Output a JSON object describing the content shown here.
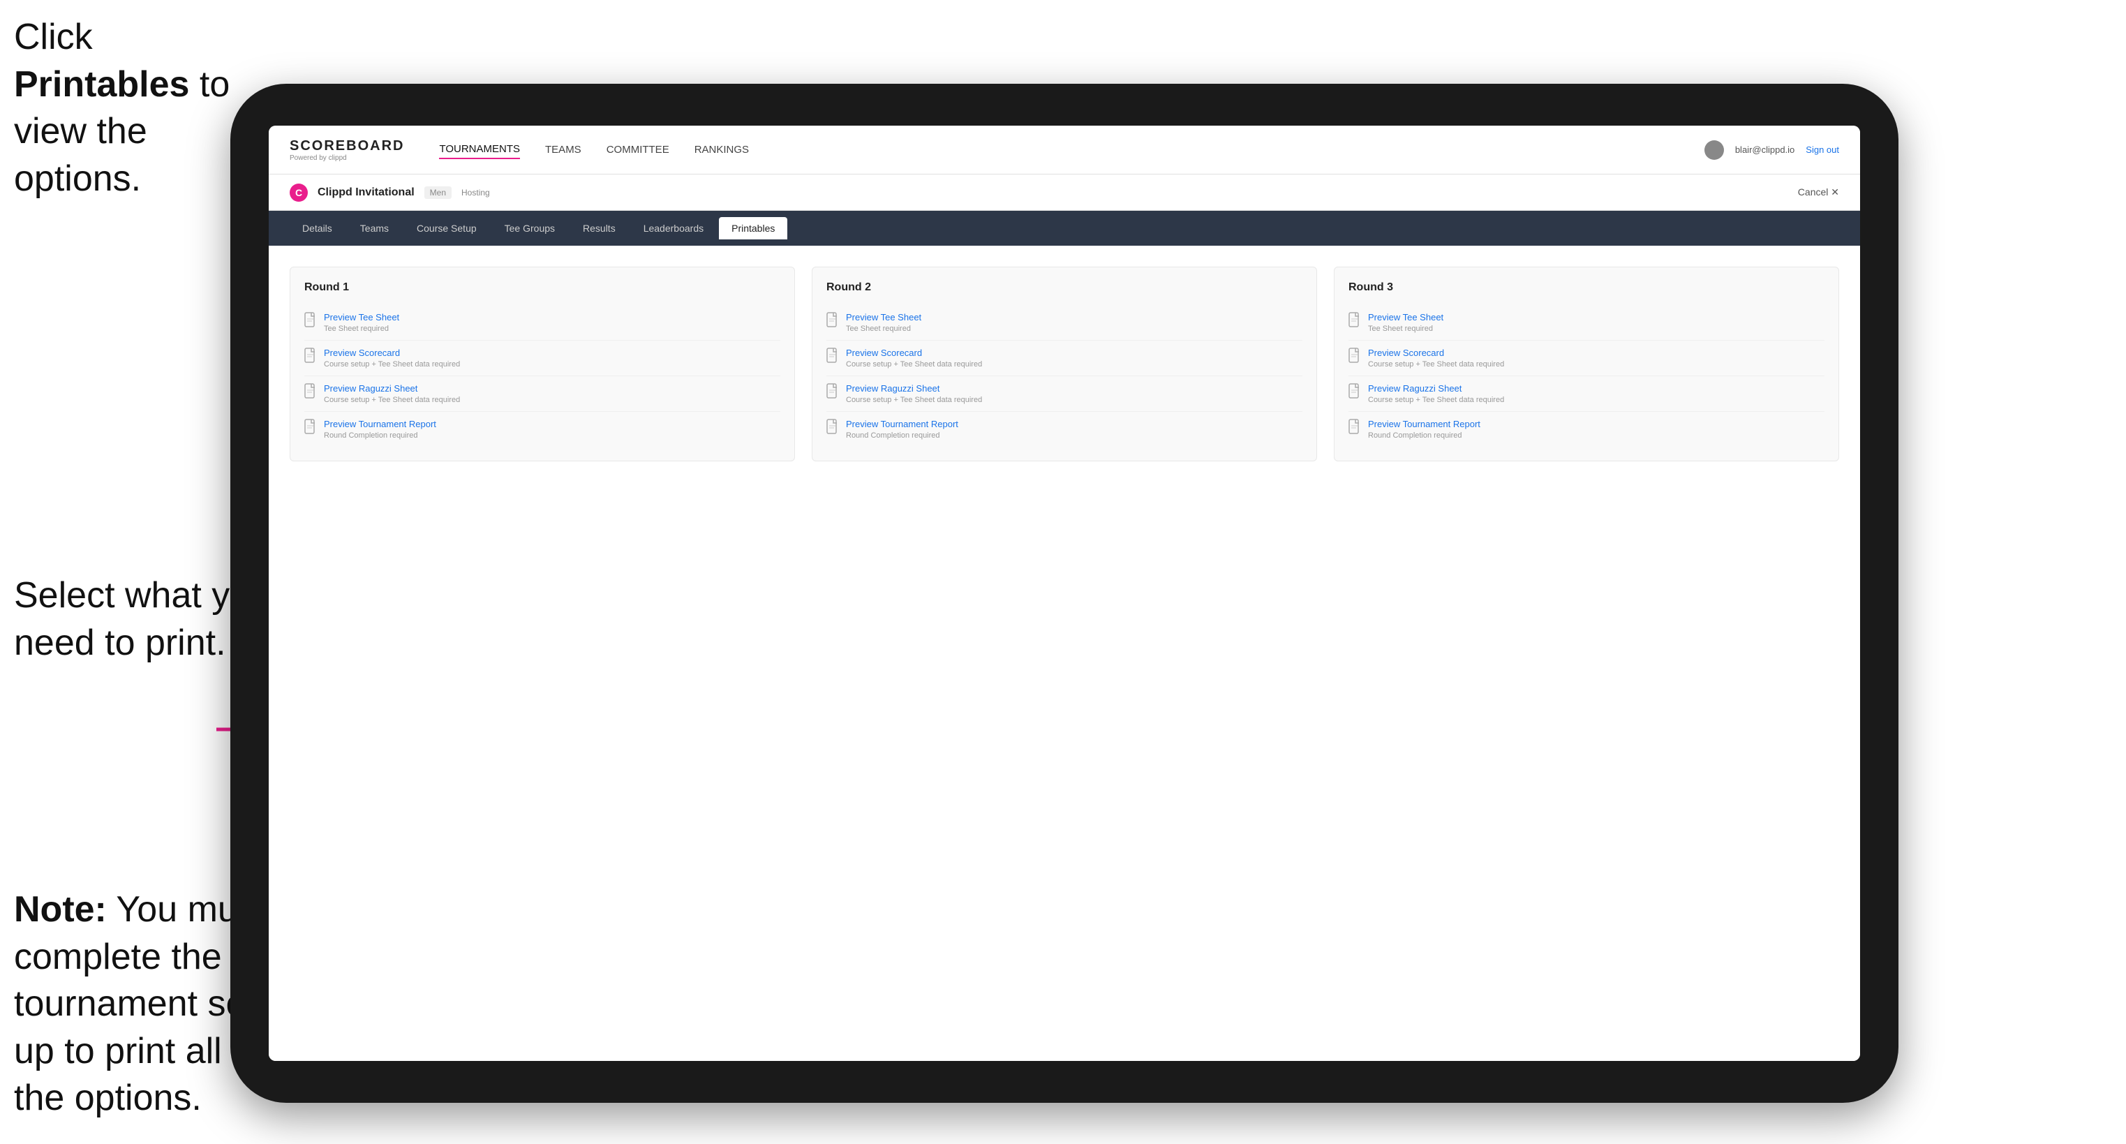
{
  "annotations": {
    "top": {
      "line1": "Click ",
      "bold": "Printables",
      "line2": " to",
      "line3": "view the options."
    },
    "middle": {
      "text": "Select what you need to print."
    },
    "bottom": {
      "bold": "Note:",
      "text": " You must complete the tournament set-up to print all the options."
    }
  },
  "topNav": {
    "brand": "SCOREBOARD",
    "brandSub": "Powered by clippd",
    "links": [
      {
        "label": "TOURNAMENTS",
        "active": true
      },
      {
        "label": "TEAMS",
        "active": false
      },
      {
        "label": "COMMITTEE",
        "active": false
      },
      {
        "label": "RANKINGS",
        "active": false
      }
    ],
    "user": "blair@clippd.io",
    "signOut": "Sign out"
  },
  "subNav": {
    "tournamentName": "Clippd Invitational",
    "badge": "Men",
    "status": "Hosting",
    "cancel": "Cancel ✕"
  },
  "tabs": [
    {
      "label": "Details",
      "active": false
    },
    {
      "label": "Teams",
      "active": false
    },
    {
      "label": "Course Setup",
      "active": false
    },
    {
      "label": "Tee Groups",
      "active": false
    },
    {
      "label": "Results",
      "active": false
    },
    {
      "label": "Leaderboards",
      "active": false
    },
    {
      "label": "Printables",
      "active": true
    }
  ],
  "rounds": [
    {
      "title": "Round 1",
      "items": [
        {
          "title": "Preview Tee Sheet",
          "subtitle": "Tee Sheet required"
        },
        {
          "title": "Preview Scorecard",
          "subtitle": "Course setup + Tee Sheet data required"
        },
        {
          "title": "Preview Raguzzi Sheet",
          "subtitle": "Course setup + Tee Sheet data required"
        },
        {
          "title": "Preview Tournament Report",
          "subtitle": "Round Completion required"
        }
      ]
    },
    {
      "title": "Round 2",
      "items": [
        {
          "title": "Preview Tee Sheet",
          "subtitle": "Tee Sheet required"
        },
        {
          "title": "Preview Scorecard",
          "subtitle": "Course setup + Tee Sheet data required"
        },
        {
          "title": "Preview Raguzzi Sheet",
          "subtitle": "Course setup + Tee Sheet data required"
        },
        {
          "title": "Preview Tournament Report",
          "subtitle": "Round Completion required"
        }
      ]
    },
    {
      "title": "Round 3",
      "items": [
        {
          "title": "Preview Tee Sheet",
          "subtitle": "Tee Sheet required"
        },
        {
          "title": "Preview Scorecard",
          "subtitle": "Course setup + Tee Sheet data required"
        },
        {
          "title": "Preview Raguzzi Sheet",
          "subtitle": "Course setup + Tee Sheet data required"
        },
        {
          "title": "Preview Tournament Report",
          "subtitle": "Round Completion required"
        }
      ]
    }
  ],
  "colors": {
    "accent": "#e91e8c",
    "navBg": "#2d3748",
    "tabActive": "#ffffff",
    "linkColor": "#1a73e8"
  }
}
